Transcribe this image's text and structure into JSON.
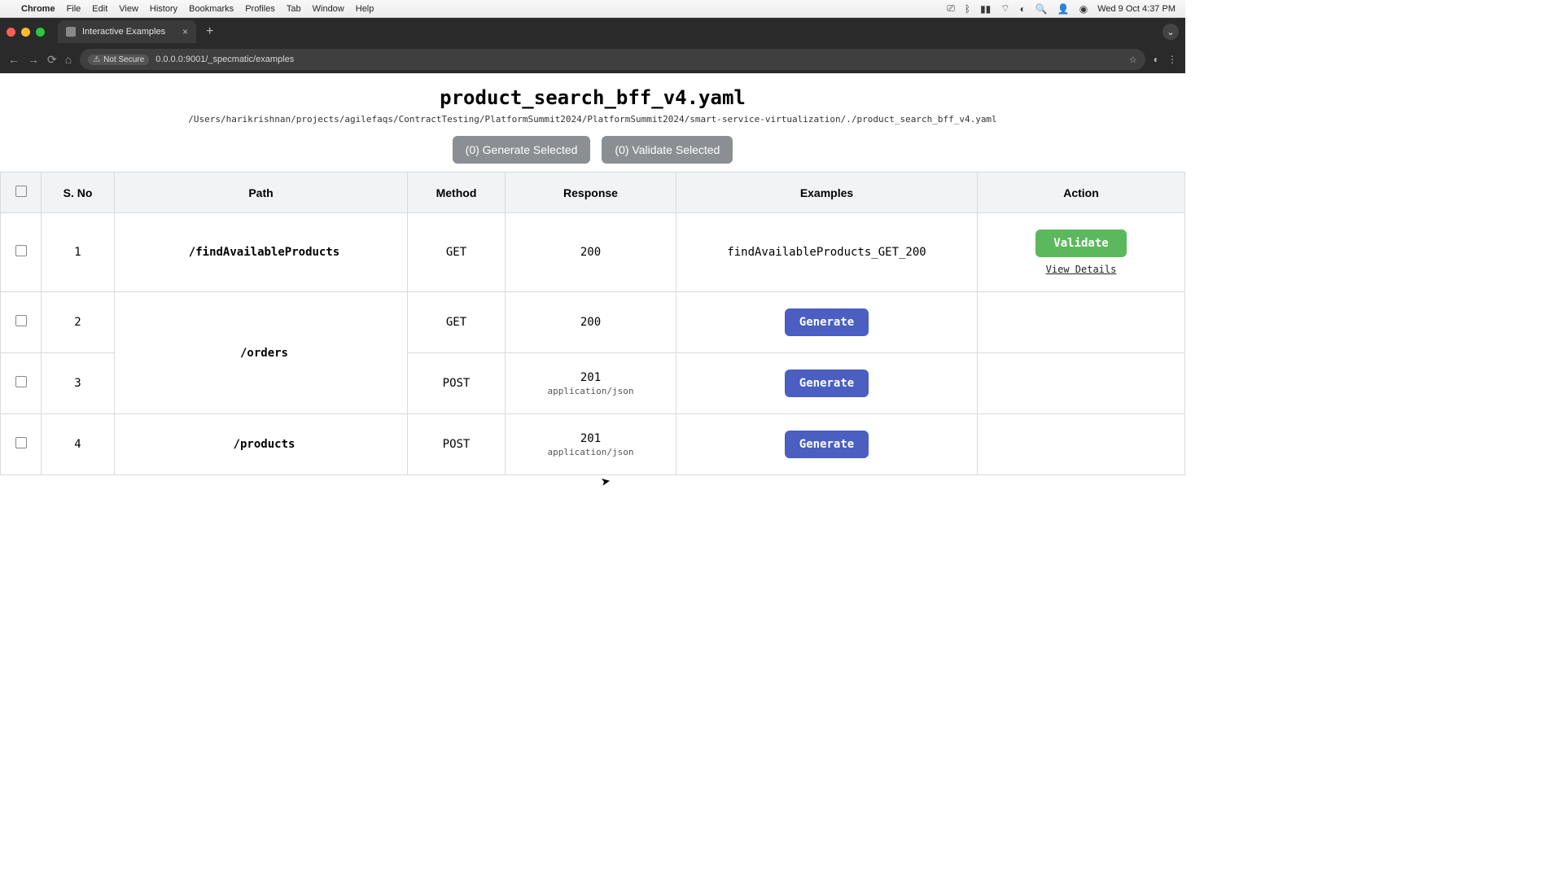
{
  "menubar": {
    "app": "Chrome",
    "items": [
      "File",
      "Edit",
      "View",
      "History",
      "Bookmarks",
      "Profiles",
      "Tab",
      "Window",
      "Help"
    ],
    "clock": "Wed 9 Oct 4:37 PM"
  },
  "browser": {
    "tab_title": "Interactive Examples",
    "not_secure": "Not Secure",
    "url": "0.0.0.0:9001/_specmatic/examples"
  },
  "page": {
    "title": "product_search_bff_v4.yaml",
    "path": "/Users/harikrishnan/projects/agilefaqs/ContractTesting/PlatformSummit2024/PlatformSummit2024/smart-service-virtualization/./product_search_bff_v4.yaml",
    "generate_selected": "(0) Generate Selected",
    "validate_selected": "(0) Validate Selected"
  },
  "table": {
    "headers": {
      "sno": "S. No",
      "path": "Path",
      "method": "Method",
      "response": "Response",
      "examples": "Examples",
      "action": "Action"
    },
    "rows": [
      {
        "sno": "1",
        "path": "/findAvailableProducts",
        "method": "GET",
        "response": "200",
        "response_sub": "",
        "example": "findAvailableProducts_GET_200",
        "action": "validate",
        "validate_label": "Validate",
        "view_details": "View Details"
      },
      {
        "sno": "2",
        "path": "/orders",
        "method": "GET",
        "response": "200",
        "response_sub": "",
        "example": "",
        "action": "generate",
        "generate_label": "Generate"
      },
      {
        "sno": "3",
        "path": "",
        "method": "POST",
        "response": "201",
        "response_sub": "application/json",
        "example": "",
        "action": "generate",
        "generate_label": "Generate"
      },
      {
        "sno": "4",
        "path": "/products",
        "method": "POST",
        "response": "201",
        "response_sub": "application/json",
        "example": "",
        "action": "generate",
        "generate_label": "Generate"
      }
    ]
  }
}
